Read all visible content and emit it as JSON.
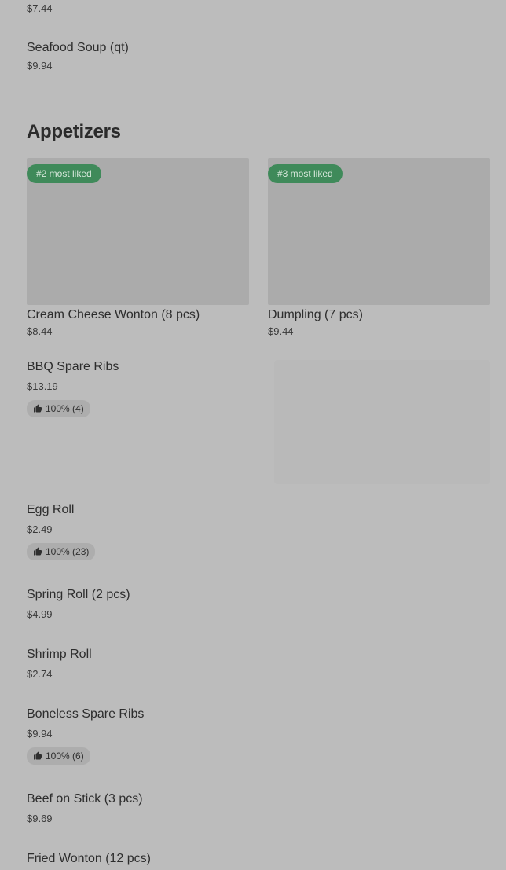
{
  "items_above": [
    {
      "price": "$7.44"
    },
    {
      "name": "Seafood Soup (qt)",
      "price": "$9.94"
    }
  ],
  "section": {
    "title": "Appetizers"
  },
  "featured": [
    {
      "badge": "#2 most liked",
      "name": "Cream Cheese Wonton (8 pcs)",
      "price": "$8.44"
    },
    {
      "badge": "#3 most liked",
      "name": "Dumpling (7 pcs)",
      "price": "$9.44"
    }
  ],
  "list": [
    {
      "name": "BBQ Spare Ribs",
      "price": "$13.19",
      "rating": "100% (4)"
    },
    {
      "name": "Egg Roll",
      "price": "$2.49",
      "rating": "100% (23)"
    },
    {
      "name": "Spring Roll (2 pcs)",
      "price": "$4.99"
    },
    {
      "name": "Shrimp Roll",
      "price": "$2.74"
    },
    {
      "name": "Boneless Spare Ribs",
      "price": "$9.94",
      "rating": "100% (6)"
    },
    {
      "name": "Beef on Stick (3 pcs)",
      "price": "$9.69"
    },
    {
      "name": "Fried Wonton (12 pcs)"
    }
  ],
  "icons": {
    "rating": "thumbs-up-icon"
  }
}
